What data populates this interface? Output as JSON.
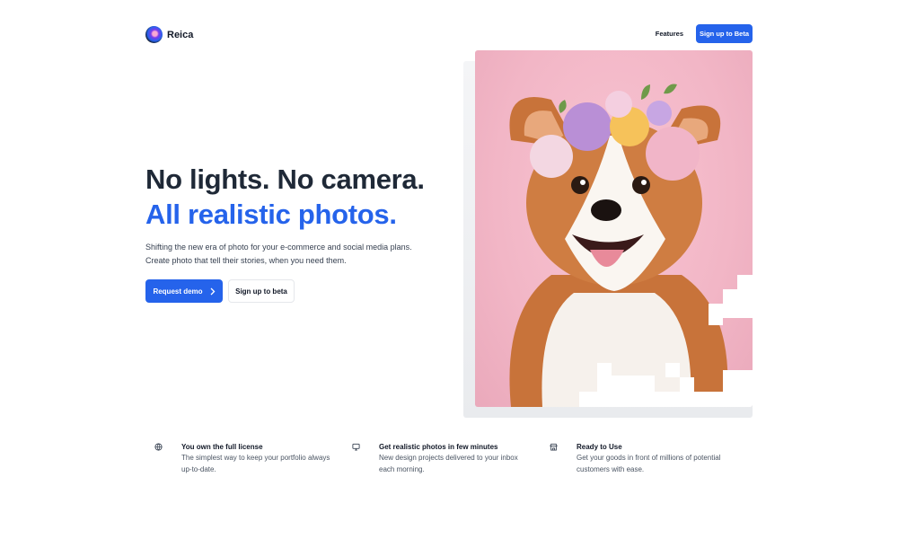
{
  "brand": {
    "name": "Reica",
    "accent": "#2563eb"
  },
  "nav": {
    "features_label": "Features",
    "cta_label": "Sign up to Beta"
  },
  "hero": {
    "headline_line1": "No lights. No camera.",
    "headline_line2": "All realistic photos.",
    "lead_line1": "Shifting the new era of photo for your e-commerce and social media plans.",
    "lead_line2": "Create photo that tell their stories, when you need them.",
    "primary_label": "Request demo",
    "primary_icon": "chevron-right-icon",
    "secondary_label": "Sign up to beta"
  },
  "features": [
    {
      "icon": "globe-icon",
      "title": "You own the full license",
      "desc": "The simplest way to keep your portfolio always up-to-date."
    },
    {
      "icon": "monitor-icon",
      "title": "Get realistic photos in few minutes",
      "desc": "New design projects delivered to your inbox each morning."
    },
    {
      "icon": "store-icon",
      "title": "Ready to Use",
      "desc": "Get your goods in front of millions of potential customers with ease."
    }
  ]
}
